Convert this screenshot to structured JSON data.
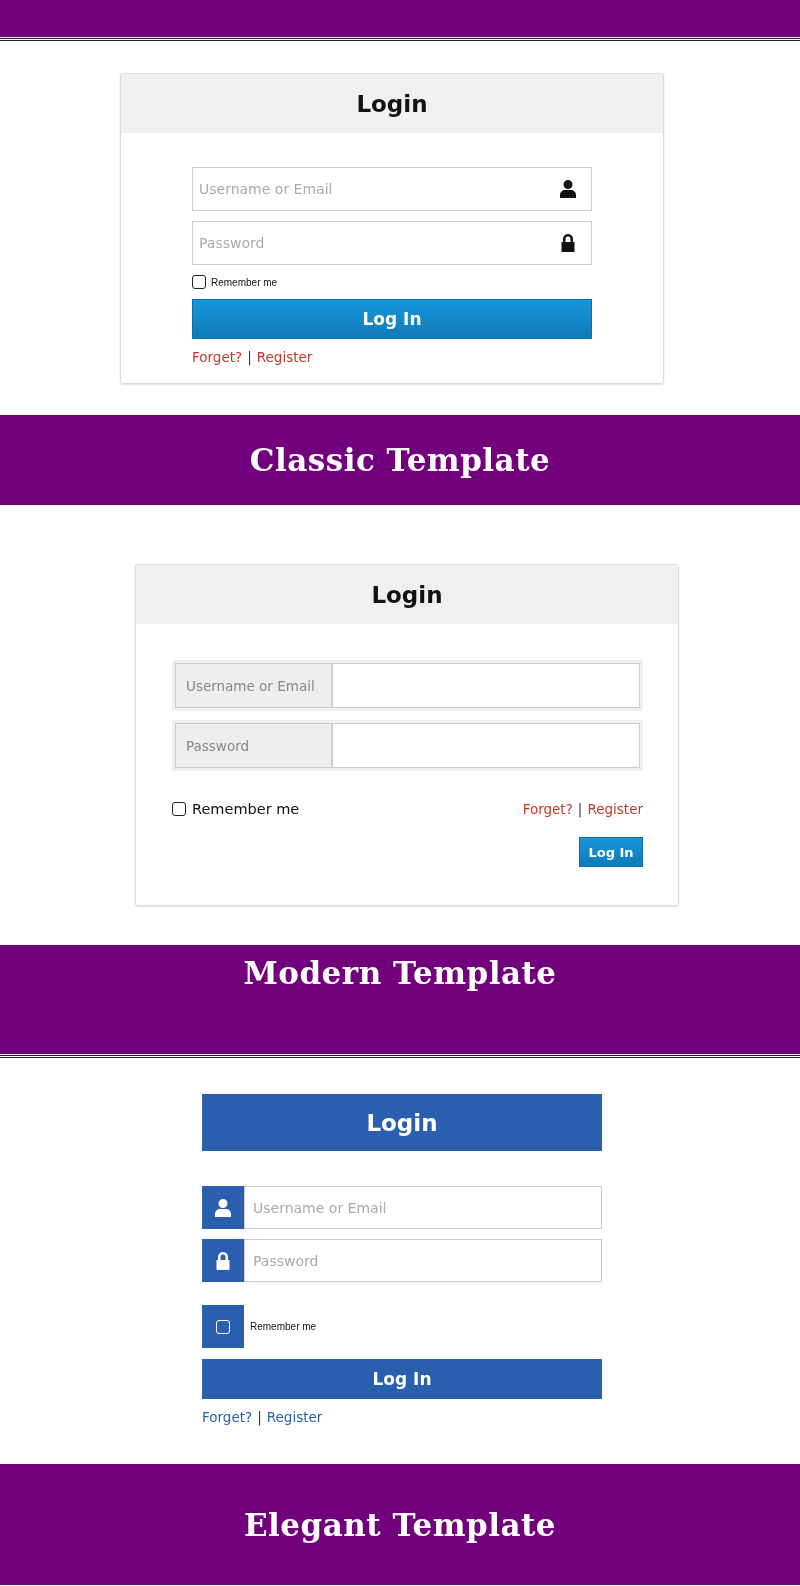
{
  "templates": [
    {
      "kind": "classic",
      "heading": "Login",
      "username": {
        "placeholder": "Username or Email"
      },
      "password": {
        "placeholder": "Password"
      },
      "remember": {
        "label": "Remember me",
        "checked": false
      },
      "button": "Log In",
      "links": {
        "forgot": "Forget?",
        "separator": "|",
        "register": "Register"
      },
      "caption": "Classic Template"
    },
    {
      "kind": "modern",
      "heading": "Login",
      "username": {
        "label": "Username or Email"
      },
      "password": {
        "label": "Password"
      },
      "remember": {
        "label": "Remember me",
        "checked": false
      },
      "button": "Log In",
      "links": {
        "forgot": "Forget?",
        "separator": "|",
        "register": "Register"
      },
      "caption": "Modern Template"
    },
    {
      "kind": "elegant",
      "heading": "Login",
      "username": {
        "placeholder": "Username or Email"
      },
      "password": {
        "placeholder": "Password"
      },
      "remember": {
        "label": "Remember me",
        "checked": false
      },
      "button": "Log In",
      "links": {
        "forgot": "Forget?",
        "separator": "|",
        "register": "Register"
      },
      "caption": "Elegant Template"
    }
  ]
}
